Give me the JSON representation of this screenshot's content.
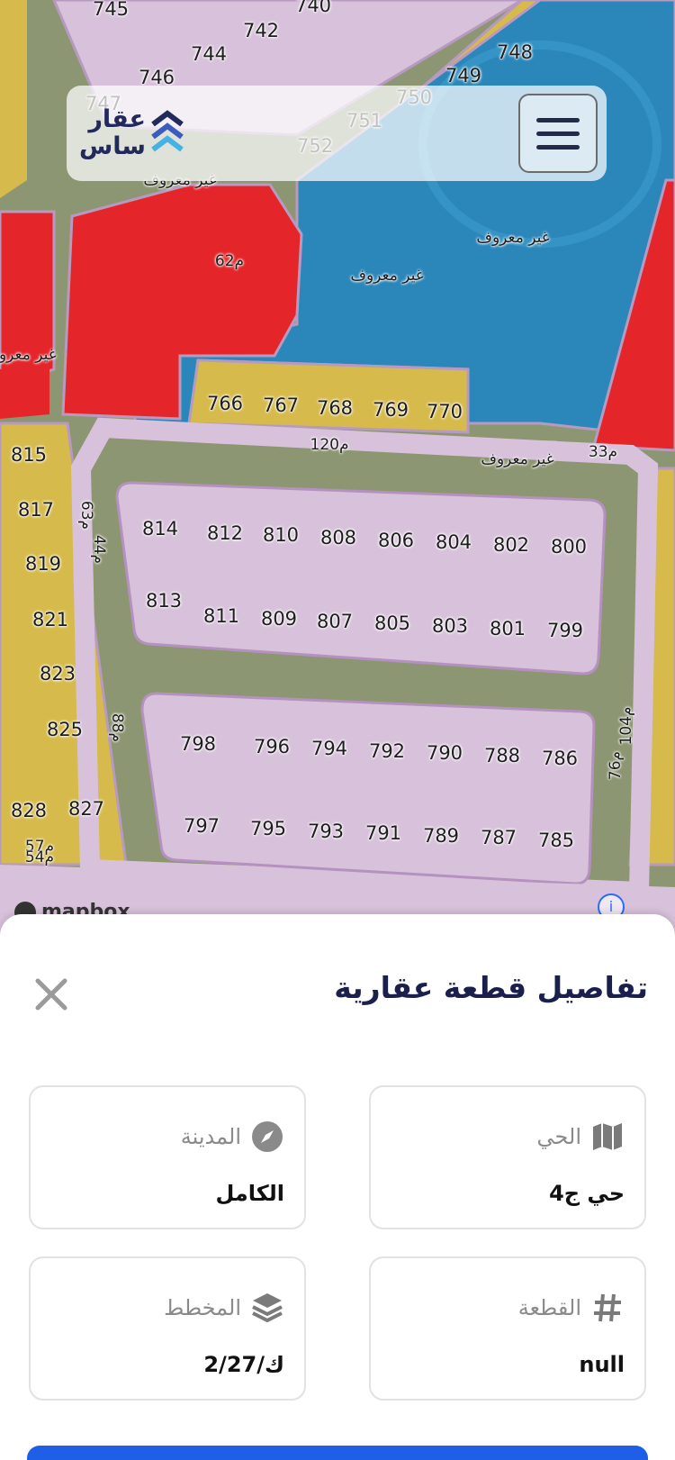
{
  "app": {
    "logo_line1": "عقار",
    "logo_line2": "ساس",
    "logo_icon": "chevron-stack-icon",
    "menu_icon": "hamburger-menu-icon"
  },
  "map": {
    "attribution": "mapbox",
    "info_icon": "info-icon",
    "plot_labels": [
      "745",
      "740",
      "742",
      "744",
      "746",
      "747",
      "748",
      "749",
      "750",
      "751",
      "752",
      "766",
      "767",
      "768",
      "769",
      "770",
      "815",
      "817",
      "819",
      "821",
      "823",
      "825",
      "827",
      "828",
      "814",
      "812",
      "810",
      "808",
      "806",
      "804",
      "802",
      "800",
      "813",
      "811",
      "809",
      "807",
      "805",
      "803",
      "801",
      "799",
      "798",
      "796",
      "794",
      "792",
      "790",
      "788",
      "786",
      "797",
      "795",
      "793",
      "791",
      "789",
      "787",
      "785"
    ],
    "street_labels": [
      "62م",
      "غير معروف",
      "غير معروف",
      "غير معروف",
      "غير معروف",
      "غير معروف",
      "120م",
      "33م",
      "44م",
      "63م",
      "88م",
      "104م",
      "76م",
      "57م",
      "54م"
    ]
  },
  "sheet": {
    "title": "تفاصيل قطعة عقارية",
    "close_icon": "close-icon",
    "cards": [
      {
        "label": "الحي",
        "value": "حي ج4",
        "icon": "map-icon"
      },
      {
        "label": "المدينة",
        "value": "الكامل",
        "icon": "compass-icon"
      },
      {
        "label": "القطعة",
        "value": "null",
        "icon": "hash-icon"
      },
      {
        "label": "المخطط",
        "value": "ك/2/27",
        "icon": "layers-icon"
      }
    ]
  },
  "colors": {
    "residential": "#d8c4dc",
    "commercial": "#d6b94a",
    "blue_zone": "#2a86b8",
    "red_zone": "#e5262b",
    "accent": "#1f5fe8",
    "title": "#1b1f4b"
  }
}
